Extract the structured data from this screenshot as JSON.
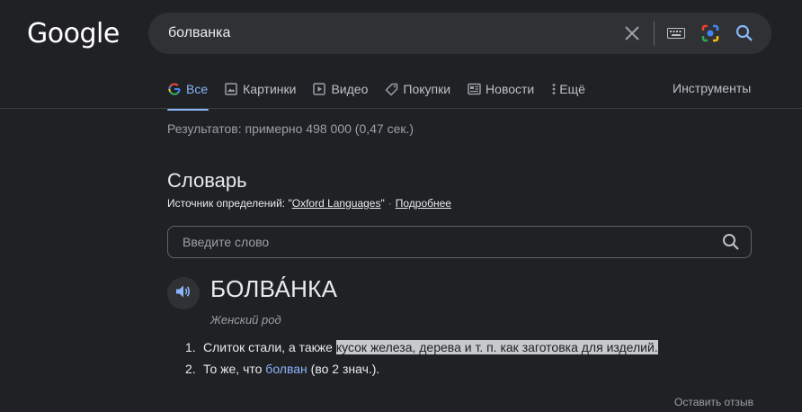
{
  "logo": "Google",
  "search": {
    "query": "болванка"
  },
  "tabs": [
    {
      "label": "Все",
      "icon": "google-g-icon"
    },
    {
      "label": "Картинки",
      "icon": "image-icon"
    },
    {
      "label": "Видео",
      "icon": "play-icon"
    },
    {
      "label": "Покупки",
      "icon": "tag-icon"
    },
    {
      "label": "Новости",
      "icon": "news-icon"
    },
    {
      "label": "Ещё",
      "icon": "more-vert-icon"
    }
  ],
  "tools_label": "Инструменты",
  "results_stats": "Результатов: примерно 498 000 (0,47 сек.)",
  "dictionary": {
    "title": "Словарь",
    "source_prefix": "Источник определений: \"",
    "source_name": "Oxford Languages",
    "source_suffix": "\"",
    "separator": "·",
    "more_link": "Подробнее",
    "input_placeholder": "Введите слово",
    "headword": "БОЛВА́НКА",
    "part_of_speech": "Женский род",
    "definitions": {
      "d1": {
        "num": "1.",
        "plain": "Слиток стали, а также ",
        "highlighted": "кусок железа, дерева и т. п. как заготовка для изделий."
      },
      "d2": {
        "num": "2.",
        "before": "То же, что ",
        "link": "болван",
        "after": " (во 2 знач.)."
      }
    }
  },
  "feedback": "Оставить отзыв",
  "colors": {
    "background": "#202124",
    "link": "#8ab4f8",
    "text": "#e8eaed",
    "muted": "#9aa0a6"
  }
}
